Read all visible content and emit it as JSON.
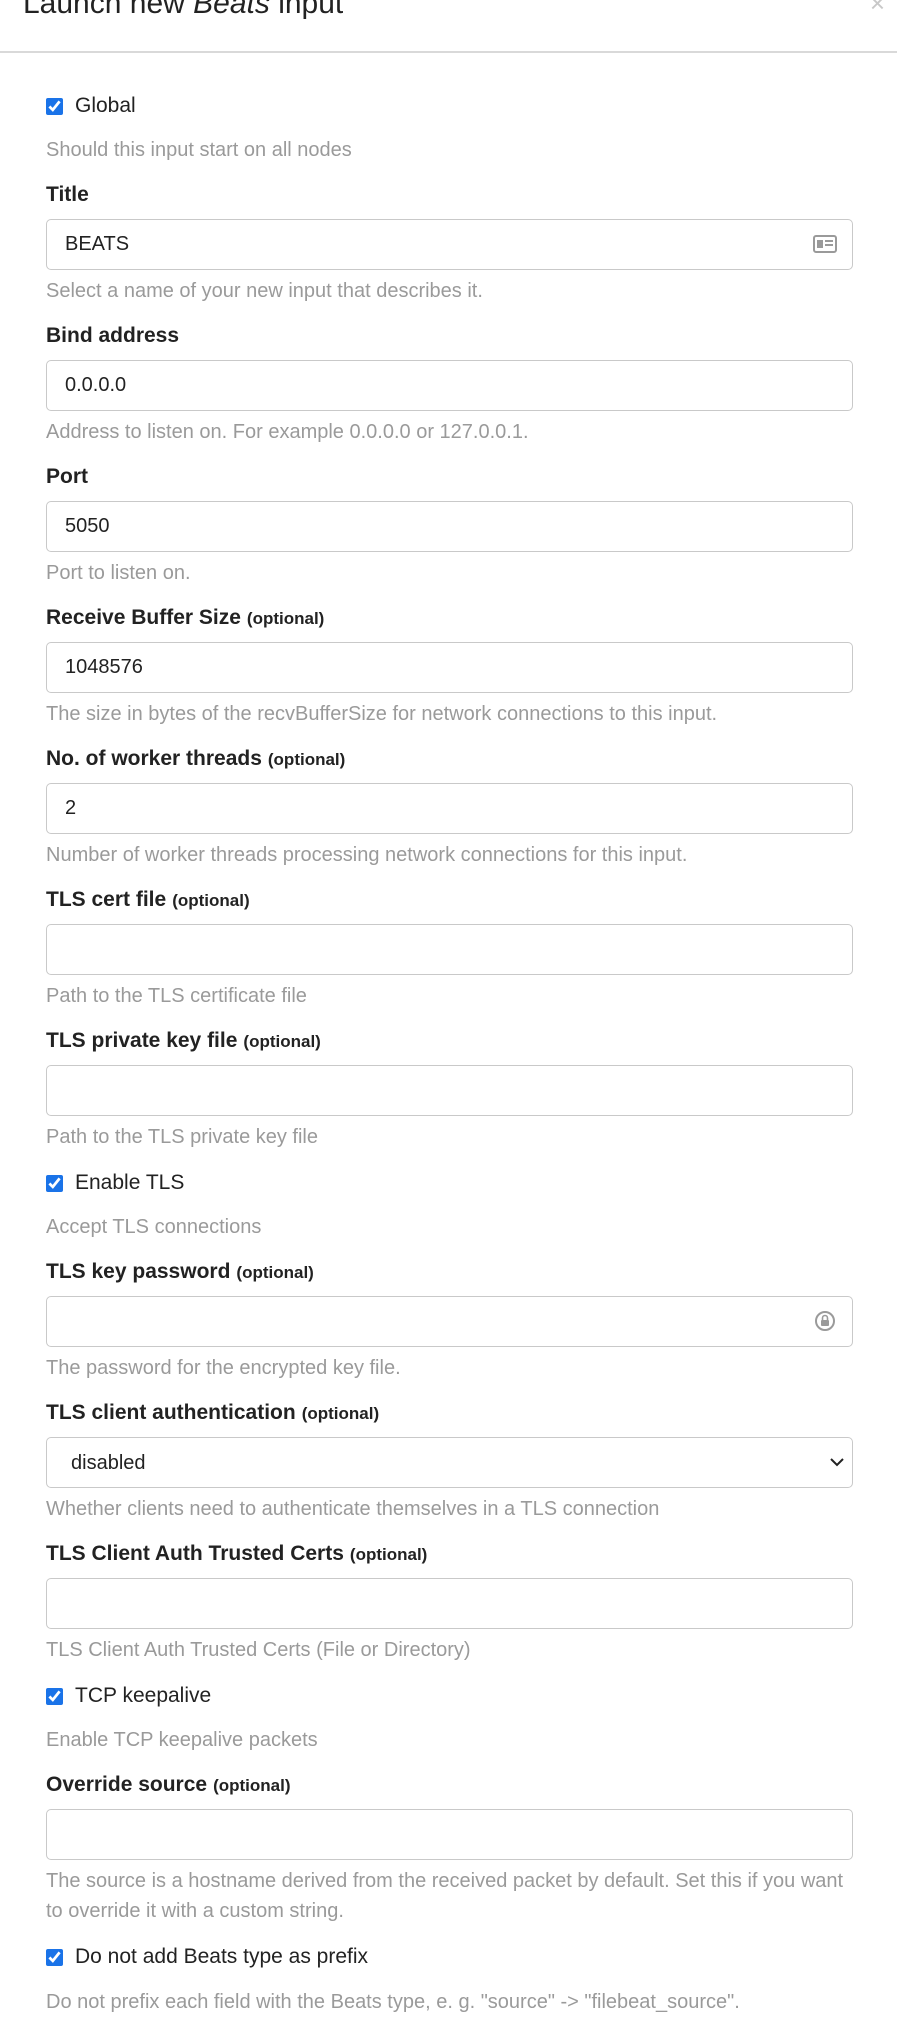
{
  "modal": {
    "title_prefix": "Launch new ",
    "title_emphasis": "Beats",
    "title_suffix": " input",
    "close_glyph": "×"
  },
  "fields": {
    "global": {
      "label": "Global",
      "checked": true,
      "help": "Should this input start on all nodes"
    },
    "title": {
      "label": "Title",
      "value": "BEATS",
      "help": "Select a name of your new input that describes it.",
      "icon": "contact-card-icon"
    },
    "bind_address": {
      "label": "Bind address",
      "value": "0.0.0.0",
      "help": "Address to listen on. For example 0.0.0.0 or 127.0.0.1."
    },
    "port": {
      "label": "Port",
      "value": "5050",
      "help": "Port to listen on."
    },
    "recv_buffer": {
      "label": "Receive Buffer Size",
      "optional": "(optional)",
      "value": "1048576",
      "help": "The size in bytes of the recvBufferSize for network connections to this input."
    },
    "worker_threads": {
      "label": "No. of worker threads",
      "optional": "(optional)",
      "value": "2",
      "help": "Number of worker threads processing network connections for this input."
    },
    "tls_cert": {
      "label": "TLS cert file",
      "optional": "(optional)",
      "value": "",
      "help": "Path to the TLS certificate file"
    },
    "tls_key": {
      "label": "TLS private key file",
      "optional": "(optional)",
      "value": "",
      "help": "Path to the TLS private key file"
    },
    "enable_tls": {
      "label": "Enable TLS",
      "checked": true,
      "help": "Accept TLS connections"
    },
    "tls_key_password": {
      "label": "TLS key password",
      "optional": "(optional)",
      "value": "",
      "help": "The password for the encrypted key file.",
      "icon": "password-manager-icon"
    },
    "tls_client_auth": {
      "label": "TLS client authentication",
      "optional": "(optional)",
      "selected": "disabled",
      "help": "Whether clients need to authenticate themselves in a TLS connection"
    },
    "tls_trusted_certs": {
      "label": "TLS Client Auth Trusted Certs",
      "optional": "(optional)",
      "value": "",
      "help": "TLS Client Auth Trusted Certs (File or Directory)"
    },
    "tcp_keepalive": {
      "label": "TCP keepalive",
      "checked": true,
      "help": "Enable TCP keepalive packets"
    },
    "override_source": {
      "label": "Override source",
      "optional": "(optional)",
      "value": "",
      "help": "The source is a hostname derived from the received packet by default. Set this if you want to override it with a custom string."
    },
    "no_beats_prefix": {
      "label": "Do not add Beats type as prefix",
      "checked": true,
      "help": "Do not prefix each field with the Beats type, e. g. \"source\" -> \"filebeat_source\"."
    }
  },
  "colors": {
    "accent": "#1a73e8",
    "help_text": "#9a9a9a",
    "border": "#c9c9c9"
  }
}
